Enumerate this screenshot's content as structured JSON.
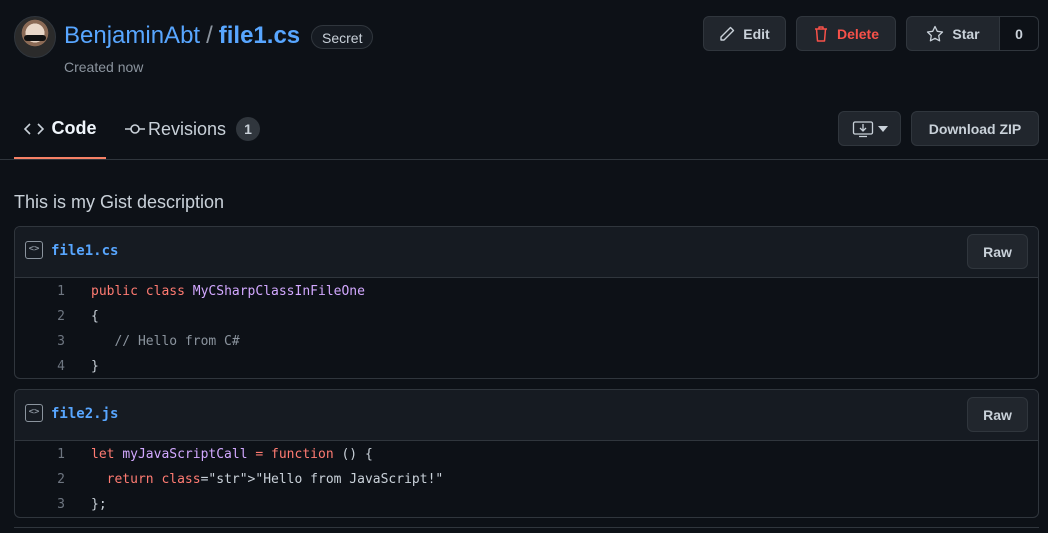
{
  "header": {
    "owner": "BenjaminAbt",
    "separator": "/",
    "gist_name": "file1.cs",
    "visibility_badge": "Secret",
    "created": "Created now",
    "edit_label": "Edit",
    "delete_label": "Delete",
    "star_label": "Star",
    "star_count": "0"
  },
  "tabs": [
    {
      "label": "Code",
      "active": true
    },
    {
      "label": "Revisions",
      "count": "1"
    }
  ],
  "actions": {
    "download_zip": "Download ZIP"
  },
  "description": "This is my Gist description",
  "files": [
    {
      "name": "file1.cs",
      "raw_label": "Raw",
      "lines": [
        {
          "n": "1",
          "text": "public class MyCSharpClassInFileOne"
        },
        {
          "n": "2",
          "text": "{"
        },
        {
          "n": "3",
          "text": "   // Hello from C#"
        },
        {
          "n": "4",
          "text": "}"
        }
      ]
    },
    {
      "name": "file2.js",
      "raw_label": "Raw",
      "lines": [
        {
          "n": "1",
          "text": "let myJavaScriptCall = function () {"
        },
        {
          "n": "2",
          "text": "  return \"Hello from JavaScript!\""
        },
        {
          "n": "3",
          "text": "};"
        }
      ]
    }
  ],
  "colors": {
    "background": "#0d1117",
    "link": "#58a6ff",
    "danger": "#f85149",
    "tab_underline": "#f78166",
    "keyword": "#ff7b72",
    "entity": "#d2a8ff",
    "string": "#a5d6ff"
  }
}
